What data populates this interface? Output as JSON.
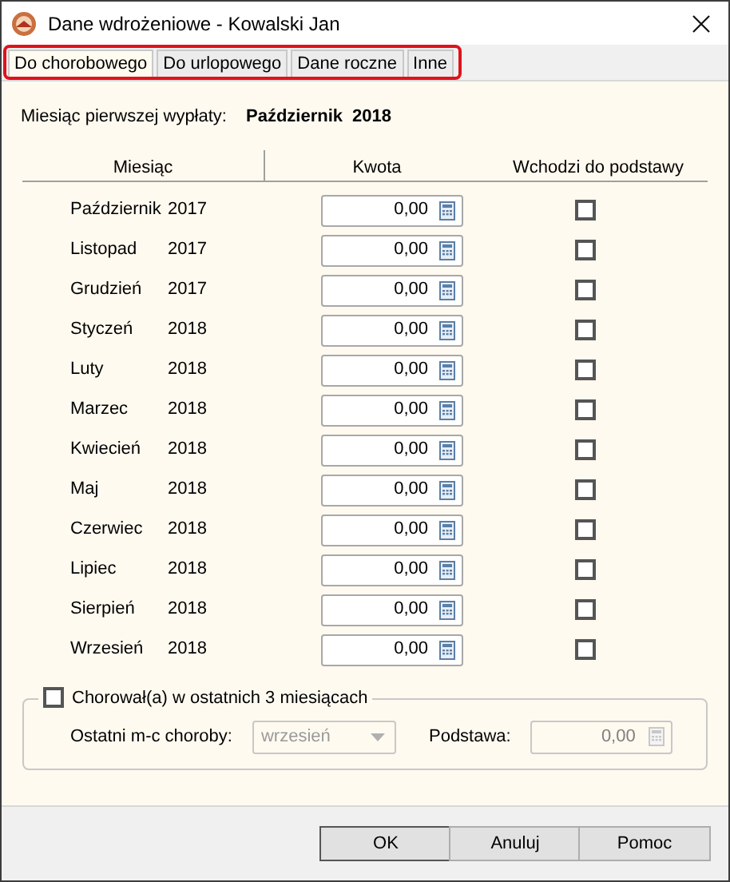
{
  "window": {
    "title": "Dane wdrożeniowe - Kowalski Jan"
  },
  "tabs": [
    {
      "label": "Do chorobowego",
      "selected": true
    },
    {
      "label": "Do urlopowego",
      "selected": false
    },
    {
      "label": "Dane roczne",
      "selected": false
    },
    {
      "label": "Inne",
      "selected": false
    }
  ],
  "tabs_highlighted": true,
  "first_payment": {
    "label": "Miesiąc pierwszej wypłaty:",
    "month": "Październik",
    "year": "2018"
  },
  "table": {
    "columns": [
      "Miesiąc",
      "Kwota",
      "Wchodzi do podstawy"
    ],
    "rows": [
      {
        "month": "Październik",
        "year": "2017",
        "amount": "0,00",
        "checked": false
      },
      {
        "month": "Listopad",
        "year": "2017",
        "amount": "0,00",
        "checked": false
      },
      {
        "month": "Grudzień",
        "year": "2017",
        "amount": "0,00",
        "checked": false
      },
      {
        "month": "Styczeń",
        "year": "2018",
        "amount": "0,00",
        "checked": false
      },
      {
        "month": "Luty",
        "year": "2018",
        "amount": "0,00",
        "checked": false
      },
      {
        "month": "Marzec",
        "year": "2018",
        "amount": "0,00",
        "checked": false
      },
      {
        "month": "Kwiecień",
        "year": "2018",
        "amount": "0,00",
        "checked": false
      },
      {
        "month": "Maj",
        "year": "2018",
        "amount": "0,00",
        "checked": false
      },
      {
        "month": "Czerwiec",
        "year": "2018",
        "amount": "0,00",
        "checked": false
      },
      {
        "month": "Lipiec",
        "year": "2018",
        "amount": "0,00",
        "checked": false
      },
      {
        "month": "Sierpień",
        "year": "2018",
        "amount": "0,00",
        "checked": false
      },
      {
        "month": "Wrzesień",
        "year": "2018",
        "amount": "0,00",
        "checked": false
      }
    ]
  },
  "sickness": {
    "label": "Chorował(a) w ostatnich 3 miesiącach",
    "checked": false,
    "last_month_label": "Ostatni m-c choroby:",
    "last_month": "wrzesień",
    "disabled": true,
    "base_label": "Podstawa:",
    "base": "0,00"
  },
  "buttons": [
    "OK",
    "Anuluj",
    "Pomoc"
  ]
}
